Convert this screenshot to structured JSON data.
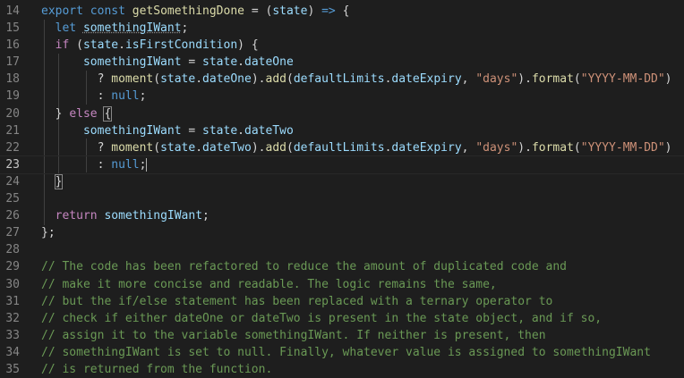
{
  "editor": {
    "theme": {
      "background": "#1e1e1e",
      "keyword": "#569cd6",
      "control": "#c586c0",
      "function": "#dcdcaa",
      "variable": "#9cdcfe",
      "string": "#ce9178",
      "comment": "#6a9955"
    },
    "active_line": "23",
    "lines": [
      {
        "n": "14",
        "t": [
          [
            "kw",
            "export "
          ],
          [
            "kw",
            "const "
          ],
          [
            "fn",
            "getSomethingDone"
          ],
          [
            "pu",
            " = ("
          ],
          [
            "var",
            "state"
          ],
          [
            "pu",
            ") "
          ],
          [
            "kw",
            "=>"
          ],
          [
            "pu",
            " {"
          ]
        ]
      },
      {
        "n": "15",
        "t": [
          [
            "pu",
            "  "
          ],
          [
            "kw",
            "let "
          ],
          [
            "var",
            "somethingIWant"
          ],
          [
            "pu",
            ";"
          ]
        ]
      },
      {
        "n": "16",
        "t": [
          [
            "pu",
            "  "
          ],
          [
            "kw2",
            "if"
          ],
          [
            "pu",
            " ("
          ],
          [
            "var",
            "state"
          ],
          [
            "pu",
            "."
          ],
          [
            "var",
            "isFirstCondition"
          ],
          [
            "pu",
            ") {"
          ]
        ]
      },
      {
        "n": "17",
        "t": [
          [
            "pu",
            "      "
          ],
          [
            "var",
            "somethingIWant"
          ],
          [
            "pu",
            " = "
          ],
          [
            "var",
            "state"
          ],
          [
            "pu",
            "."
          ],
          [
            "var",
            "dateOne"
          ]
        ]
      },
      {
        "n": "18",
        "t": [
          [
            "pu",
            "        ? "
          ],
          [
            "fn",
            "moment"
          ],
          [
            "pu",
            "("
          ],
          [
            "var",
            "state"
          ],
          [
            "pu",
            "."
          ],
          [
            "var",
            "dateOne"
          ],
          [
            "pu",
            ")."
          ],
          [
            "fn",
            "add"
          ],
          [
            "pu",
            "("
          ],
          [
            "var",
            "defaultLimits"
          ],
          [
            "pu",
            "."
          ],
          [
            "var",
            "dateExpiry"
          ],
          [
            "pu",
            ", "
          ],
          [
            "str",
            "\"days\""
          ],
          [
            "pu",
            ")."
          ],
          [
            "fn",
            "format"
          ],
          [
            "pu",
            "("
          ],
          [
            "str",
            "\"YYYY-MM-DD\""
          ],
          [
            "pu",
            ")"
          ]
        ]
      },
      {
        "n": "19",
        "t": [
          [
            "pu",
            "        : "
          ],
          [
            "kw",
            "null"
          ],
          [
            "pu",
            ";"
          ]
        ]
      },
      {
        "n": "20",
        "t": [
          [
            "pu",
            "  } "
          ],
          [
            "kw2",
            "else"
          ],
          [
            "pu",
            " {"
          ]
        ]
      },
      {
        "n": "21",
        "t": [
          [
            "pu",
            "      "
          ],
          [
            "var",
            "somethingIWant"
          ],
          [
            "pu",
            " = "
          ],
          [
            "var",
            "state"
          ],
          [
            "pu",
            "."
          ],
          [
            "var",
            "dateTwo"
          ]
        ]
      },
      {
        "n": "22",
        "t": [
          [
            "pu",
            "        ? "
          ],
          [
            "fn",
            "moment"
          ],
          [
            "pu",
            "("
          ],
          [
            "var",
            "state"
          ],
          [
            "pu",
            "."
          ],
          [
            "var",
            "dateTwo"
          ],
          [
            "pu",
            ")."
          ],
          [
            "fn",
            "add"
          ],
          [
            "pu",
            "("
          ],
          [
            "var",
            "defaultLimits"
          ],
          [
            "pu",
            "."
          ],
          [
            "var",
            "dateExpiry"
          ],
          [
            "pu",
            ", "
          ],
          [
            "str",
            "\"days\""
          ],
          [
            "pu",
            ")."
          ],
          [
            "fn",
            "format"
          ],
          [
            "pu",
            "("
          ],
          [
            "str",
            "\"YYYY-MM-DD\""
          ],
          [
            "pu",
            ")"
          ]
        ]
      },
      {
        "n": "23",
        "t": [
          [
            "pu",
            "        : "
          ],
          [
            "kw",
            "null"
          ],
          [
            "pu",
            ";"
          ]
        ]
      },
      {
        "n": "24",
        "t": [
          [
            "pu",
            "  }"
          ]
        ]
      },
      {
        "n": "25",
        "t": []
      },
      {
        "n": "26",
        "t": [
          [
            "pu",
            "  "
          ],
          [
            "kw2",
            "return "
          ],
          [
            "var",
            "somethingIWant"
          ],
          [
            "pu",
            ";"
          ]
        ]
      },
      {
        "n": "27",
        "t": [
          [
            "pu",
            "};"
          ]
        ]
      },
      {
        "n": "28",
        "t": []
      },
      {
        "n": "29",
        "t": [
          [
            "cm",
            "// The code has been refactored to reduce the amount of duplicated code and"
          ]
        ]
      },
      {
        "n": "30",
        "t": [
          [
            "cm",
            "// make it more concise and readable. The logic remains the same,"
          ]
        ]
      },
      {
        "n": "31",
        "t": [
          [
            "cm",
            "// but the if/else statement has been replaced with a ternary operator to"
          ]
        ]
      },
      {
        "n": "32",
        "t": [
          [
            "cm",
            "// check if either dateOne or dateTwo is present in the state object, and if so,"
          ]
        ]
      },
      {
        "n": "33",
        "t": [
          [
            "cm",
            "// assign it to the variable somethingIWant. If neither is present, then"
          ]
        ]
      },
      {
        "n": "34",
        "t": [
          [
            "cm",
            "// somethingIWant is set to null. Finally, whatever value is assigned to somethingIWant"
          ]
        ]
      },
      {
        "n": "35",
        "t": [
          [
            "cm",
            "// is returned from the function."
          ]
        ]
      }
    ]
  }
}
